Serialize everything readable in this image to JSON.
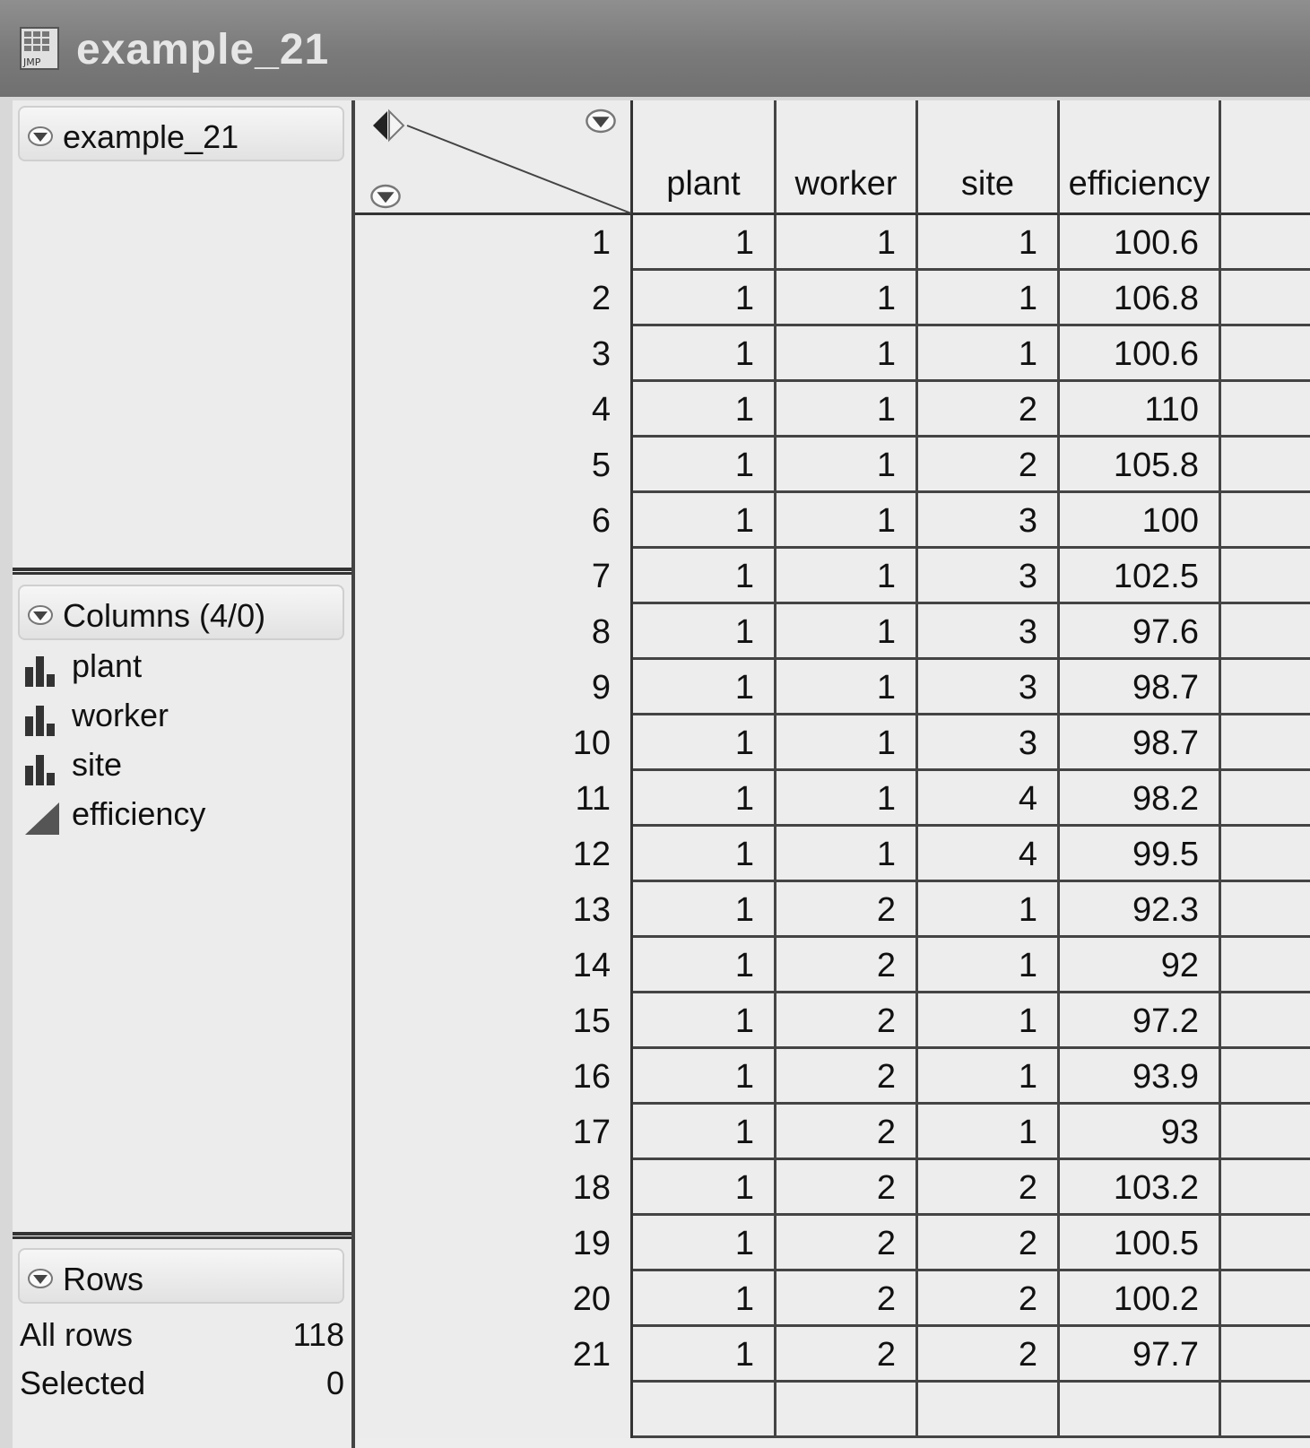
{
  "window": {
    "title": "example_21",
    "icon": "jmp-table-icon"
  },
  "left_panel": {
    "table_panel": {
      "title": "example_21"
    },
    "columns_panel": {
      "title": "Columns (4/0)",
      "columns": [
        {
          "name": "plant",
          "icon": "nominal-icon"
        },
        {
          "name": "worker",
          "icon": "nominal-icon"
        },
        {
          "name": "site",
          "icon": "nominal-icon"
        },
        {
          "name": "efficiency",
          "icon": "continuous-icon"
        }
      ]
    },
    "rows_panel": {
      "title": "Rows",
      "stats": [
        {
          "label": "All rows",
          "value": "118"
        },
        {
          "label": "Selected",
          "value": "0"
        }
      ]
    }
  },
  "table": {
    "headers": [
      "plant",
      "worker",
      "site",
      "efficiency"
    ],
    "rows": [
      [
        "1",
        "1",
        "1",
        "1",
        "100.6"
      ],
      [
        "2",
        "1",
        "1",
        "1",
        "106.8"
      ],
      [
        "3",
        "1",
        "1",
        "1",
        "100.6"
      ],
      [
        "4",
        "1",
        "1",
        "2",
        "110"
      ],
      [
        "5",
        "1",
        "1",
        "2",
        "105.8"
      ],
      [
        "6",
        "1",
        "1",
        "3",
        "100"
      ],
      [
        "7",
        "1",
        "1",
        "3",
        "102.5"
      ],
      [
        "8",
        "1",
        "1",
        "3",
        "97.6"
      ],
      [
        "9",
        "1",
        "1",
        "3",
        "98.7"
      ],
      [
        "10",
        "1",
        "1",
        "3",
        "98.7"
      ],
      [
        "11",
        "1",
        "1",
        "4",
        "98.2"
      ],
      [
        "12",
        "1",
        "1",
        "4",
        "99.5"
      ],
      [
        "13",
        "1",
        "2",
        "1",
        "92.3"
      ],
      [
        "14",
        "1",
        "2",
        "1",
        "92"
      ],
      [
        "15",
        "1",
        "2",
        "1",
        "97.2"
      ],
      [
        "16",
        "1",
        "2",
        "1",
        "93.9"
      ],
      [
        "17",
        "1",
        "2",
        "1",
        "93"
      ],
      [
        "18",
        "1",
        "2",
        "2",
        "103.2"
      ],
      [
        "19",
        "1",
        "2",
        "2",
        "100.5"
      ],
      [
        "20",
        "1",
        "2",
        "2",
        "100.2"
      ],
      [
        "21",
        "1",
        "2",
        "2",
        "97.7"
      ]
    ]
  },
  "colors": {
    "titlebar": "#7a7a7a",
    "grid_line": "#444444",
    "cell_bg": "#ededed"
  }
}
